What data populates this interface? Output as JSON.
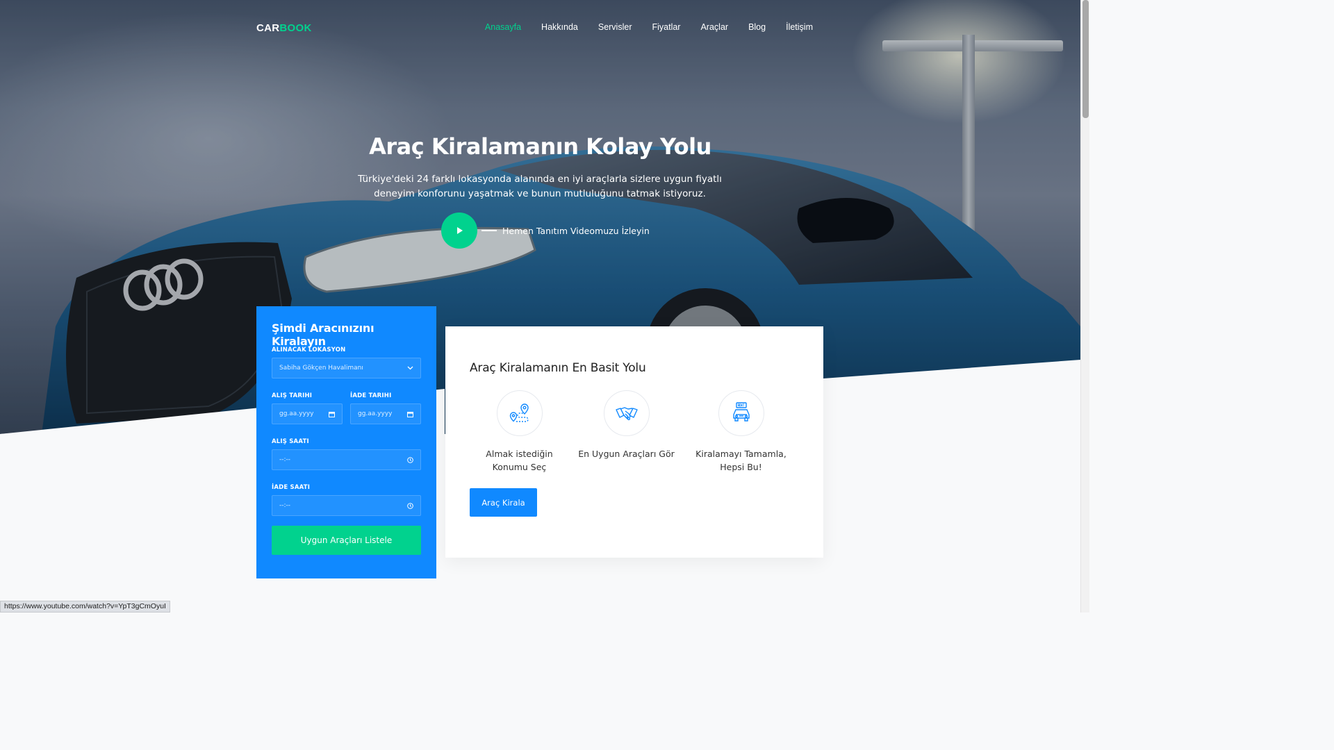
{
  "nav": {
    "logo_primary": "CAR",
    "logo_accent": "BOOK",
    "items": [
      {
        "label": "Anasayfa",
        "active": true
      },
      {
        "label": "Hakkında"
      },
      {
        "label": "Servisler"
      },
      {
        "label": "Fiyatlar"
      },
      {
        "label": "Araçlar"
      },
      {
        "label": "Blog"
      },
      {
        "label": "İletişim"
      }
    ]
  },
  "hero": {
    "title": "Araç Kiralamanın Kolay Yolu",
    "subtitle": "Türkiye'deki 24 farklı lokasyonda alanında en iyi araçlarla sizlere uygun fiyatlı deneyim konforunu yaşatmak ve bunun mutluluğunu tatmak istiyoruz.",
    "video_label": "Hemen Tanıtım Videomuzu İzleyin",
    "play_icon": "play-icon"
  },
  "booking": {
    "title": "Şimdi Aracınızını Kiralayın",
    "location_label": "ALINACAK LOKASYON",
    "location_value": "Sabiha Gökçen Havalimanı",
    "pickup_date_label": "ALIŞ TARIHI",
    "return_date_label": "İADE TARIHI",
    "date_placeholder": "gg.aa.yyyy",
    "pickup_time_label": "ALIŞ SAATI",
    "return_time_label": "İADE SAATI",
    "time_placeholder": "--:--",
    "submit_label": "Uygun Araçları Listele"
  },
  "info": {
    "title": "Araç Kiralamanın En Basit Yolu",
    "steps": [
      {
        "text": "Almak istediğin Konumu Seç",
        "icon": "route-location-icon"
      },
      {
        "text": "En Uygun Araçları Gör",
        "icon": "handshake-icon"
      },
      {
        "text": "Kiralamayı Tamamla, Hepsi Bu!",
        "icon": "rent-car-icon"
      }
    ],
    "button_label": "Araç Kirala"
  },
  "status_bar": {
    "url": "https://www.youtube.com/watch?v=YpT3gCmOyuI"
  },
  "colors": {
    "accent_green": "#01d28e",
    "primary_blue": "#1089ff"
  }
}
